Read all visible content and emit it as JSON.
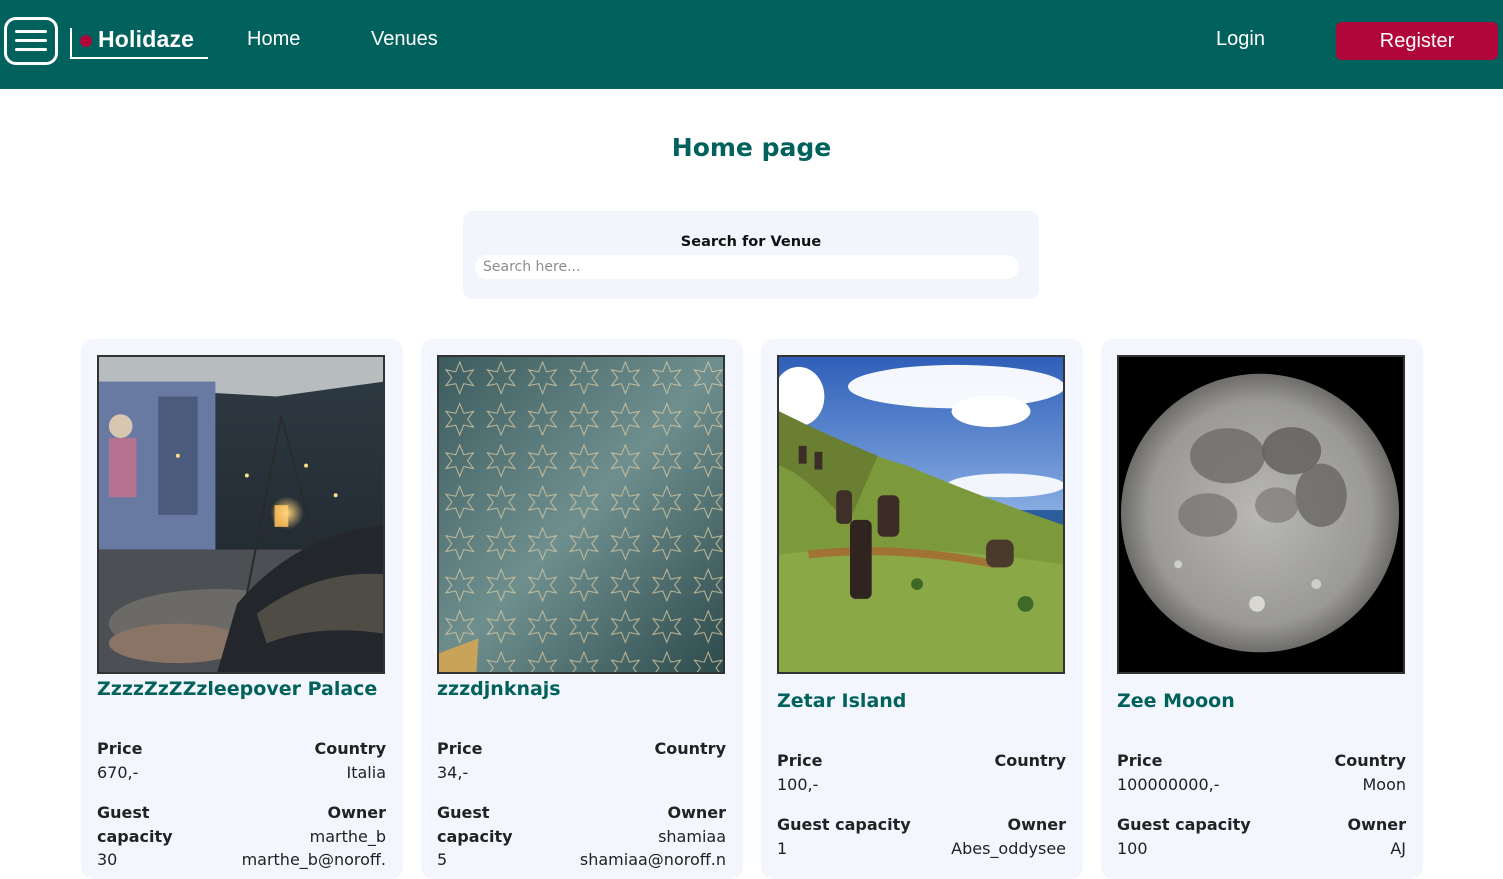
{
  "header": {
    "logo": "Holidaze",
    "nav": {
      "home": "Home",
      "venues": "Venues"
    },
    "login": "Login",
    "register": "Register"
  },
  "page_title": "Home page",
  "search": {
    "label": "Search for Venue",
    "placeholder": "Search here..."
  },
  "labels": {
    "price": "Price",
    "country": "Country",
    "guest_capacity": "Guest capacity",
    "guest": "Guest",
    "capacity": "capacity",
    "owner": "Owner"
  },
  "venues": [
    {
      "name": "ZzzzZzZZzleepover Palace",
      "price": "670,-",
      "country": "Italia",
      "guests": "30",
      "owner": "marthe_b",
      "owner_email": "marthe_b@noroff."
    },
    {
      "name": "zzzdjnknajs",
      "price": "34,-",
      "country": "",
      "guests": "5",
      "owner": "shamiaa",
      "owner_email": "shamiaa@noroff.n"
    },
    {
      "name": "Zetar Island",
      "price": "100,-",
      "country": "",
      "guests": "1",
      "owner": "Abes_oddysee"
    },
    {
      "name": "Zee Mooon",
      "price": "100000000,-",
      "country": "Moon",
      "guests": "100",
      "owner": "AJ"
    }
  ],
  "colors": {
    "header": "#01615c",
    "accent": "#b1063a",
    "card": "#f3f6fd"
  },
  "icons": {
    "menu": "hamburger-menu-icon",
    "logo_dot": "logo-dot-icon"
  }
}
